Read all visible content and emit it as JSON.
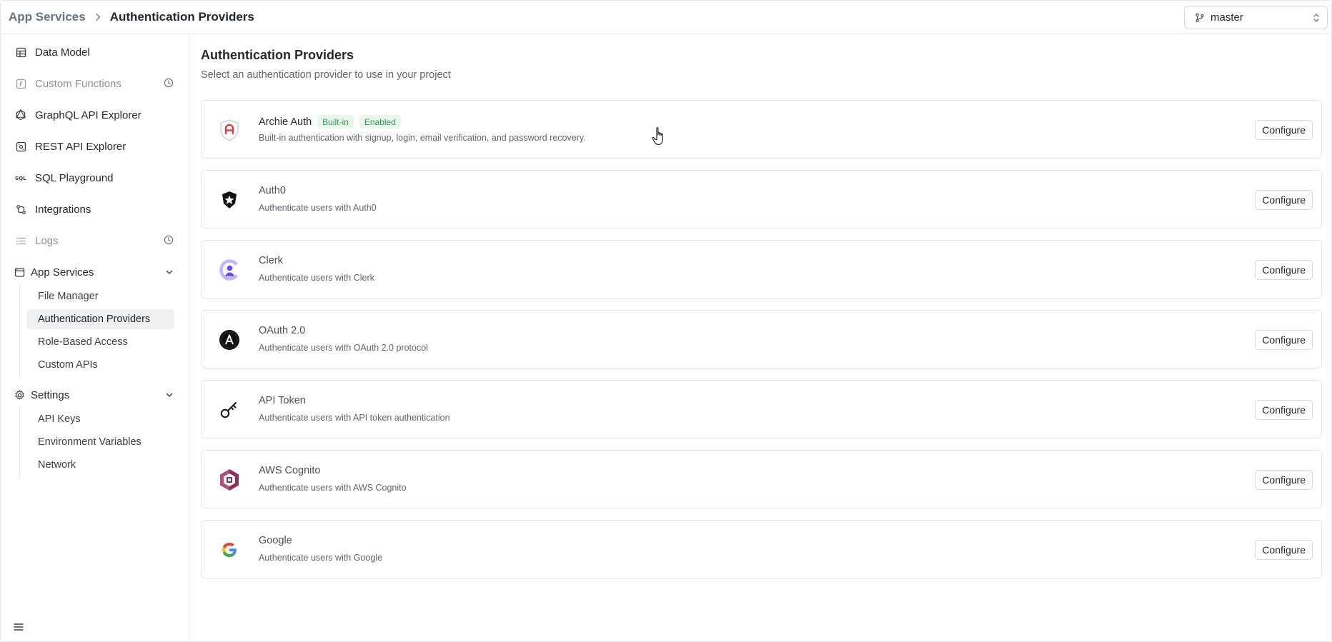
{
  "breadcrumb": {
    "root": "App Services",
    "current": "Authentication Providers"
  },
  "branch": {
    "label": "master",
    "icon": "git-branch-icon"
  },
  "sidebar": {
    "items": [
      {
        "label": "Data Model",
        "icon": "table-icon",
        "disabled": false
      },
      {
        "label": "Custom Functions",
        "icon": "function-icon",
        "disabled": true,
        "badge_icon": "clock-icon"
      },
      {
        "label": "GraphQL API Explorer",
        "icon": "graphql-icon",
        "disabled": false
      },
      {
        "label": "REST API Explorer",
        "icon": "rest-api-icon",
        "disabled": false
      },
      {
        "label": "SQL Playground",
        "icon": "sql-icon",
        "disabled": false
      },
      {
        "label": "Integrations",
        "icon": "integrations-icon",
        "disabled": false
      },
      {
        "label": "Logs",
        "icon": "logs-icon",
        "disabled": true,
        "badge_icon": "clock-icon"
      }
    ],
    "app_services": {
      "label": "App Services",
      "icon": "browser-window-icon",
      "expanded": true,
      "children": [
        "File Manager",
        "Authentication Providers",
        "Role-Based Access",
        "Custom APIs"
      ],
      "active": "Authentication Providers"
    },
    "settings": {
      "label": "Settings",
      "icon": "gear-icon",
      "expanded": true,
      "children": [
        "API Keys",
        "Environment Variables",
        "Network"
      ]
    },
    "footer_icon": "menu-icon"
  },
  "main": {
    "title": "Authentication Providers",
    "subtitle": "Select an authentication provider to use in your project",
    "providers": [
      {
        "name": "Archie Auth",
        "desc": "Built-in authentication with signup, login, email verification, and password recovery.",
        "badges": [
          "Built-in",
          "Enabled"
        ],
        "icon": "archie-shield-icon",
        "action": "Configure"
      },
      {
        "name": "Auth0",
        "desc": "Authenticate users with Auth0",
        "badges": [],
        "icon": "auth0-icon",
        "action": "Configure"
      },
      {
        "name": "Clerk",
        "desc": "Authenticate users with Clerk",
        "badges": [],
        "icon": "clerk-icon",
        "action": "Configure"
      },
      {
        "name": "OAuth 2.0",
        "desc": "Authenticate users with OAuth 2.0 protocol",
        "badges": [],
        "icon": "oauth-icon",
        "action": "Configure"
      },
      {
        "name": "API Token",
        "desc": "Authenticate users with API token authentication",
        "badges": [],
        "icon": "key-icon",
        "action": "Configure"
      },
      {
        "name": "AWS Cognito",
        "desc": "Authenticate users with AWS Cognito",
        "badges": [],
        "icon": "aws-cognito-icon",
        "action": "Configure"
      },
      {
        "name": "Google",
        "desc": "Authenticate users with Google",
        "badges": [],
        "icon": "google-icon",
        "action": "Configure"
      }
    ]
  },
  "colors": {
    "badge_bg": "#e8f6ec",
    "badge_text": "#2f9e55",
    "active_bg": "#eef0f2",
    "border": "#e3e5e8"
  }
}
